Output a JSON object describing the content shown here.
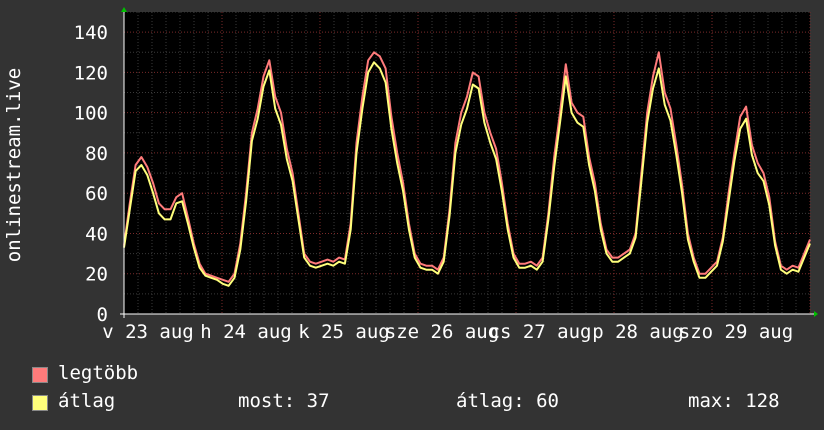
{
  "chart_data": {
    "type": "line",
    "ylabel": "onlinestream.live",
    "ylim": [
      0,
      150
    ],
    "yticks": [
      "0",
      "20",
      "40",
      "60",
      "80",
      "100",
      "120",
      "140"
    ],
    "xtick_labels": [
      "v 23 aug",
      "h 24 aug",
      "k 25 aug",
      "sze 26 aug",
      "cs 27 aug",
      "p 28 aug",
      "szo 29 aug"
    ],
    "grid": true,
    "series": [
      {
        "name": "legtöbb",
        "color": "#ff7b7b",
        "values": [
          34,
          55,
          74,
          78,
          73,
          65,
          55,
          52,
          52,
          58,
          60,
          48,
          35,
          25,
          20,
          19,
          18,
          17,
          16,
          20,
          35,
          60,
          90,
          102,
          118,
          126,
          108,
          100,
          82,
          70,
          50,
          30,
          26,
          25,
          26,
          27,
          26,
          28,
          27,
          45,
          85,
          108,
          126,
          130,
          128,
          122,
          98,
          80,
          65,
          45,
          30,
          25,
          24,
          24,
          22,
          28,
          52,
          85,
          100,
          108,
          120,
          118,
          100,
          90,
          82,
          65,
          45,
          30,
          25,
          25,
          26,
          24,
          28,
          50,
          78,
          100,
          124,
          105,
          100,
          98,
          78,
          65,
          45,
          32,
          28,
          28,
          30,
          32,
          40,
          70,
          100,
          118,
          130,
          110,
          102,
          84,
          64,
          40,
          28,
          20,
          20,
          23,
          26,
          38,
          60,
          80,
          98,
          103,
          84,
          75,
          70,
          58,
          36,
          24,
          22,
          24,
          23,
          30,
          37
        ]
      },
      {
        "name": "átlag",
        "color": "#ffff7b",
        "values": [
          33,
          52,
          71,
          74,
          69,
          60,
          50,
          47,
          47,
          55,
          56,
          45,
          33,
          23,
          19,
          18,
          17,
          15,
          14,
          18,
          32,
          56,
          86,
          97,
          113,
          121,
          102,
          94,
          77,
          66,
          47,
          28,
          24,
          23,
          24,
          25,
          24,
          26,
          25,
          42,
          80,
          102,
          120,
          125,
          122,
          115,
          92,
          75,
          61,
          42,
          28,
          23,
          22,
          22,
          20,
          26,
          49,
          80,
          94,
          102,
          114,
          112,
          95,
          85,
          77,
          61,
          42,
          28,
          23,
          23,
          24,
          22,
          26,
          47,
          73,
          95,
          118,
          100,
          95,
          93,
          74,
          61,
          42,
          30,
          26,
          26,
          28,
          30,
          38,
          66,
          95,
          112,
          122,
          104,
          96,
          79,
          60,
          37,
          26,
          18,
          18,
          21,
          24,
          36,
          56,
          76,
          92,
          97,
          79,
          70,
          66,
          54,
          34,
          22,
          20,
          22,
          21,
          28,
          35
        ]
      }
    ]
  },
  "legend": {
    "max_label": "legtöbb",
    "avg_label": "átlag",
    "max_color": "#ff7b7b",
    "avg_color": "#ffff7b"
  },
  "stats": {
    "current": "most: 37",
    "average": "átlag: 60",
    "maximum": "max: 128"
  }
}
